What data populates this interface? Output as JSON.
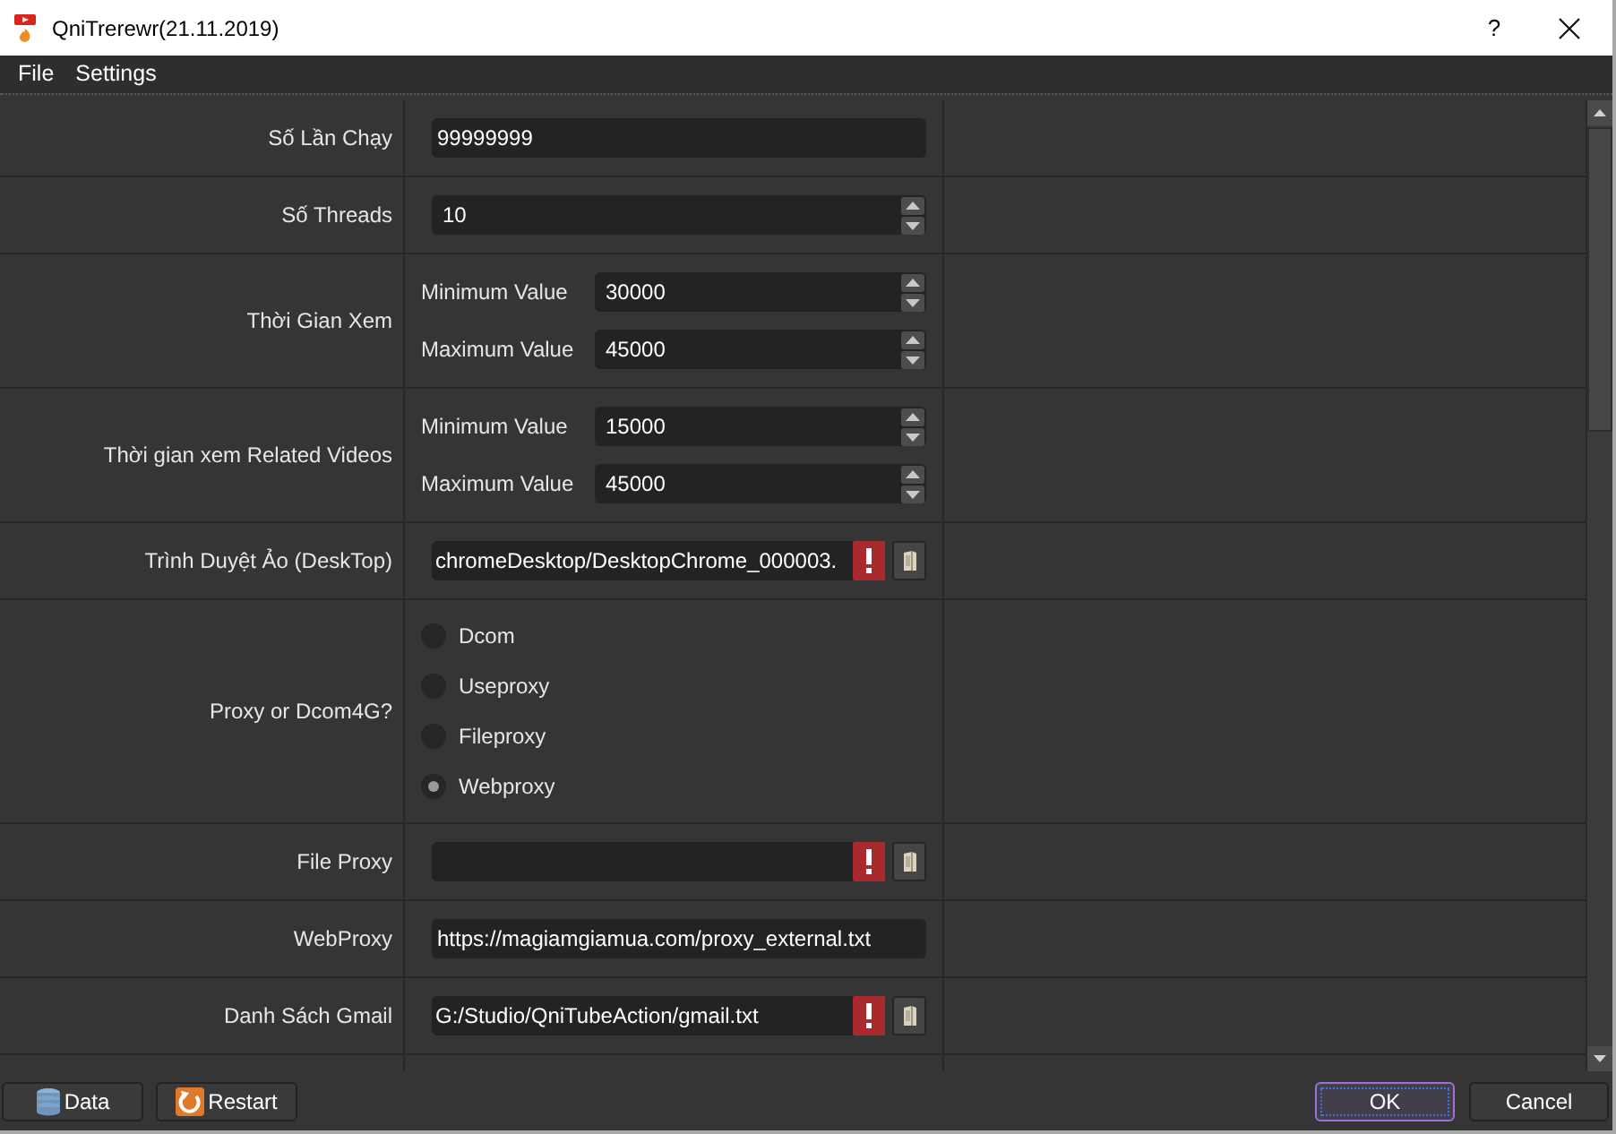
{
  "window": {
    "title": "QniTrerewr(21.11.2019)",
    "help": "?"
  },
  "menu": [
    "File",
    "Settings"
  ],
  "form": {
    "rows": [
      {
        "kind": "text",
        "label": "Số Lần Chạy",
        "value": "99999999"
      },
      {
        "kind": "spin",
        "label": "Số Threads",
        "value": "10"
      },
      {
        "kind": "range",
        "label": "Thời Gian Xem",
        "fields": [
          {
            "label": "Minimum Value",
            "value": "30000"
          },
          {
            "label": "Maximum Value",
            "value": "45000"
          }
        ]
      },
      {
        "kind": "range",
        "label": "Thời gian xem Related Videos",
        "fields": [
          {
            "label": "Minimum Value",
            "value": "15000"
          },
          {
            "label": "Maximum Value",
            "value": "45000"
          }
        ]
      },
      {
        "kind": "path",
        "label": "Trình Duyệt Ảo (DeskTop)",
        "value": "chromeDesktop/DesktopChrome_000003.",
        "error": true
      },
      {
        "kind": "radio",
        "label": "Proxy or Dcom4G?",
        "options": [
          {
            "label": "Dcom",
            "selected": false
          },
          {
            "label": "Useproxy",
            "selected": false
          },
          {
            "label": "Fileproxy",
            "selected": false
          },
          {
            "label": "Webproxy",
            "selected": true
          }
        ]
      },
      {
        "kind": "path",
        "label": "File Proxy",
        "error": true
      },
      {
        "kind": "text",
        "label": "WebProxy",
        "value": "https://magiamgiamua.com/proxy_external.txt"
      },
      {
        "kind": "path",
        "label": "Danh Sách Gmail",
        "value": "G:/Studio/QniTubeAction/gmail.txt",
        "error": true
      }
    ]
  },
  "footer": {
    "left_buttons": [
      {
        "label": "Data"
      },
      {
        "label": "Restart"
      }
    ],
    "right_buttons": [
      {
        "label": "OK",
        "focused": true
      },
      {
        "label": "Cancel",
        "focused": false
      }
    ]
  }
}
